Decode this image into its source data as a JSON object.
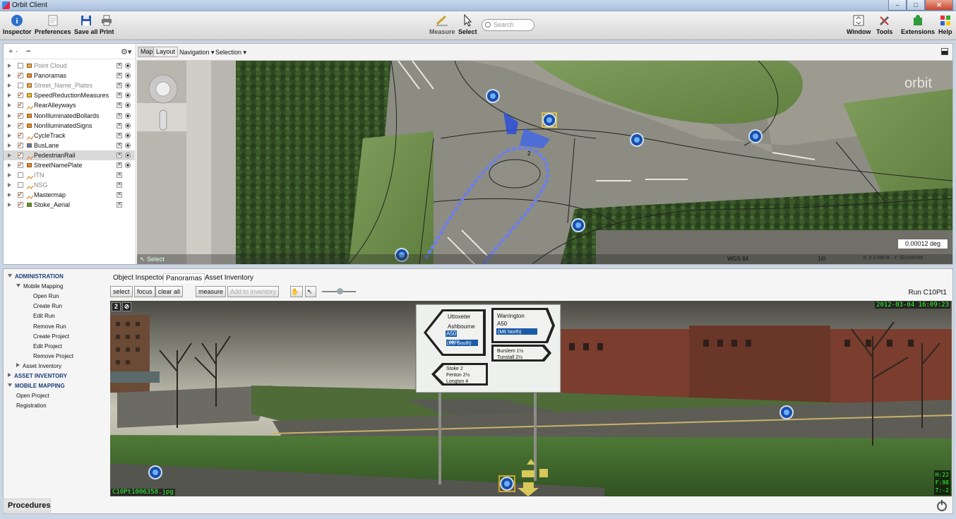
{
  "window": {
    "title": "Orbit Client",
    "controls": [
      "–",
      "□",
      "✕"
    ]
  },
  "toolbar": {
    "left": [
      "Inspector",
      "Preferences",
      "Save all",
      "Print"
    ],
    "center": [
      "Measure",
      "Select"
    ],
    "search_placeholder": "Search",
    "right": [
      "Window",
      "Tools",
      "Extensions",
      "Help"
    ]
  },
  "layers": {
    "header_add": "+ ·",
    "header_remove": "−",
    "items": [
      {
        "label": "Point Cloud",
        "checked": false,
        "dim": true,
        "sym": "#e8a84e"
      },
      {
        "label": "Panoramas",
        "checked": true,
        "dim": false,
        "sym": "#e38b2a"
      },
      {
        "label": "Street_Name_Plates",
        "checked": false,
        "dim": true,
        "sym": "#e8a84e"
      },
      {
        "label": "SpeedReductionMeasures",
        "checked": true,
        "dim": false,
        "sym": "#f3c323"
      },
      {
        "label": "RearAlleyways",
        "checked": true,
        "dim": false,
        "sym": "line"
      },
      {
        "label": "NonIlluminatedBollards",
        "checked": true,
        "dim": false,
        "sym": "#e38b2a"
      },
      {
        "label": "NonIlluminatedSigns",
        "checked": true,
        "dim": false,
        "sym": "#e38b2a"
      },
      {
        "label": "CycleTrack",
        "checked": true,
        "dim": false,
        "sym": "line"
      },
      {
        "label": "BusLane",
        "checked": true,
        "dim": false,
        "sym": "#4a7bd0"
      },
      {
        "label": "PedestrianRail",
        "checked": true,
        "dim": false,
        "sym": "line",
        "selected": true
      },
      {
        "label": "StreetNamePlate",
        "checked": true,
        "dim": false,
        "sym": "#e38b2a"
      },
      {
        "label": "ITN",
        "checked": false,
        "dim": true,
        "sym": "line"
      },
      {
        "label": "NSG",
        "checked": false,
        "dim": true,
        "sym": "line"
      },
      {
        "label": "Mastermap",
        "checked": true,
        "dim": false,
        "sym": "line"
      },
      {
        "label": "Stoke_Aerial",
        "checked": true,
        "dim": false,
        "sym": "#3aa23a"
      }
    ]
  },
  "map": {
    "tabs": [
      "Map",
      "Layout"
    ],
    "menus": [
      "Navigation ▾",
      "Selection ▾"
    ],
    "select_label": "Select",
    "scale": "0.00012 deg",
    "crs": "WGS 84",
    "page": "1/0",
    "coords": "X: 2.178878 · Y: 53.025488",
    "watermark": "orbit",
    "point_label": "2"
  },
  "procedures": {
    "items": [
      {
        "label": "ADMINISTRATION",
        "level": 0,
        "section": true,
        "open": true
      },
      {
        "label": "Mobile Mapping",
        "level": 1,
        "open": true
      },
      {
        "label": "Open Run",
        "level": 2
      },
      {
        "label": "Create Run",
        "level": 2
      },
      {
        "label": "Edit Run",
        "level": 2
      },
      {
        "label": "Remove Run",
        "level": 2
      },
      {
        "label": "Create Project",
        "level": 2
      },
      {
        "label": "Edit Project",
        "level": 2
      },
      {
        "label": "Remove Project",
        "level": 2
      },
      {
        "label": "Asset Inventory",
        "level": 1,
        "open": false
      },
      {
        "label": "ASSET INVENTORY",
        "level": 0,
        "section": true,
        "open": false
      },
      {
        "label": "MOBILE MAPPING",
        "level": 0,
        "section": true,
        "open": true
      },
      {
        "label": "Open Project",
        "level": 1
      },
      {
        "label": "Registration",
        "level": 1
      }
    ],
    "footer": "Procedures"
  },
  "pano": {
    "tabs": [
      "Object Inspector",
      "Panoramas",
      "Asset Inventory"
    ],
    "buttons": [
      "select",
      "focus",
      "clear all",
      "measure",
      "Add to inventory"
    ],
    "run": "Run C10Pt1",
    "date": "2012-03-04 16:09:23",
    "file": "C10Pt1006358.jpg",
    "hft": [
      "H:22",
      "F:98",
      "T:-2"
    ],
    "num": [
      "2",
      "⊘"
    ],
    "sign_left": [
      "Uttoxeter",
      "A50",
      "Ashbourne",
      "A522",
      "(M6 South)"
    ],
    "sign_right": [
      "Warrington",
      "A50",
      "(M6 North)",
      "Burslem 1½",
      "Tunstall 2½"
    ],
    "sign_bottom": [
      "Stoke    2",
      "Fenton  2½",
      "Longton  4"
    ]
  }
}
